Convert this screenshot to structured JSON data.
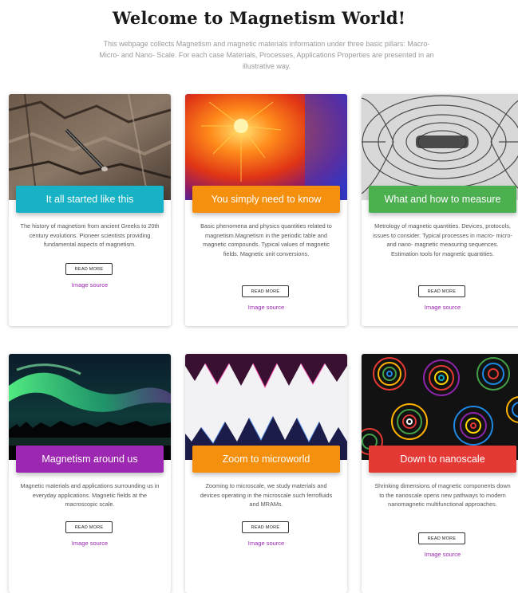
{
  "page": {
    "title": "Welcome to Magnetism World!",
    "intro": "This webpage collects Magnetism and magnetic materials information under three basic pillars: Macro- Micro- and Nano- Scale. For each case Materials, Processes, Applications Properties are presented in an illustrative way."
  },
  "cards": [
    {
      "heading": "It all started like this",
      "color": "#17b2c5",
      "description": "The history of magnetism from ancient Greeks to 20th century evolutions. Pioneer scientists providing fundamental aspects of magnetism.",
      "button": "READ MORE",
      "link": "Image source",
      "image": "lodestone-rock-photo"
    },
    {
      "heading": "You simply need to know",
      "color": "#f5900f",
      "description": "Basic phenomena and physics quantities related to magnetism.Magnetism in the periodic table and magnetic compounds. Typical values of magnetic fields. Magnetic unit conversions.",
      "button": "READ MORE",
      "link": "Image source",
      "image": "magnetic-field-heatmap"
    },
    {
      "heading": "What and how to measure",
      "color": "#4caf50",
      "description": "Metrology of magnetic quantities. Devices, protocols, issues to consider. Typical processes in macro- micro- and nano- magnetic measuring sequences. Estimation tools for magnetic quantities.",
      "button": "READ MORE",
      "link": "Image source",
      "image": "iron-filings-field-lines"
    },
    {
      "heading": "Magnetism around us",
      "color": "#9c27b0",
      "description": "Magnetic materials and applications surrounding us in everyday applications. Magnetic fields at the macroscopic scale.",
      "button": "READ MORE",
      "link": "Image source",
      "image": "aurora-borealis-photo"
    },
    {
      "heading": "Zoom to microworld",
      "color": "#f5900f",
      "description": "Zooming to microscale, we study materials and devices operating in the microscale such ferrofluids and MRAMs.",
      "button": "READ MORE",
      "link": "Image source",
      "image": "ferrofluid-spikes-photo"
    },
    {
      "heading": "Down to nanoscale",
      "color": "#e53935",
      "description": "Shrinking dimensions of magnetic components down to the nanoscale opens new pathways to modern nanomagnetic multifunctional approaches.",
      "button": "READ MORE",
      "link": "Image source",
      "image": "nanoscale-spin-texture"
    }
  ]
}
